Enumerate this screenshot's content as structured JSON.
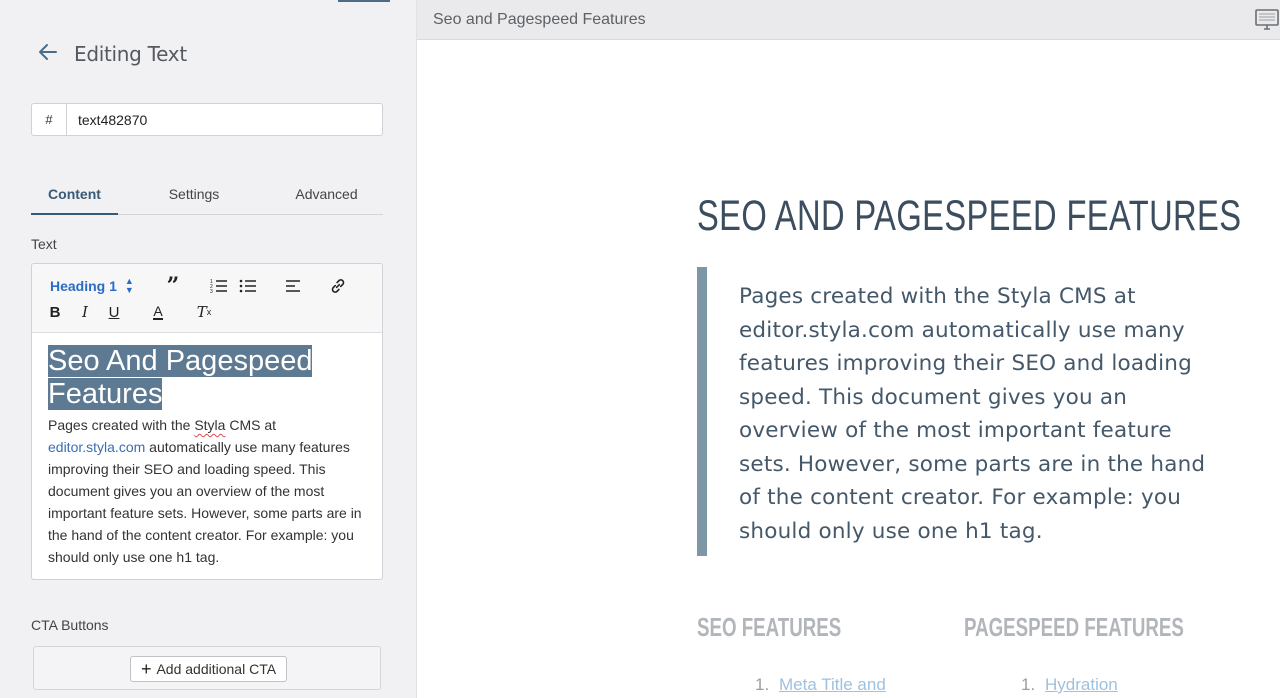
{
  "panel": {
    "title": "Editing Text",
    "id_prefix": "#",
    "id_value": "text482870",
    "tabs": [
      {
        "label": "Content",
        "active": true
      },
      {
        "label": "Settings",
        "active": false
      },
      {
        "label": "Advanced",
        "active": false
      }
    ],
    "text_label": "Text",
    "toolbar": {
      "heading_select": "Heading 1",
      "quote": "”",
      "bold": "B",
      "italic": "I",
      "underline": "U",
      "font_color": "A",
      "clear_format": "T"
    },
    "editor": {
      "heading_line1": "Seo And Pagespeed",
      "heading_line2": "Features",
      "para_part1": "Pages created with the ",
      "para_misspelled": "Styla",
      "para_part2": " CMS at ",
      "para_link": "editor.styla.com",
      "para_part3": " automatically use many features improving their SEO and loading speed. This document gives you an overview of the most important feature sets. However, some parts are in the hand of the content creator. For example: you should only use one h1 tag."
    },
    "cta_label": "CTA Buttons",
    "cta_button": "Add additional CTA"
  },
  "preview": {
    "bar_title": "Seo and Pagespeed Features",
    "heading": "SEO AND PAGESPEED FEATURES",
    "quote": "Pages created with the Styla CMS at editor.styla.com automatically use many features improving their SEO and loading speed. This document gives you an overview of the most important feature sets. However, some parts are in the hand of the content creator. For example: you should only use one h1 tag.",
    "columns": [
      {
        "title": "SEO FEATURES",
        "first_item_number": "1.",
        "first_item": "Meta Title and"
      },
      {
        "title": "PAGESPEED FEATURES",
        "first_item_number": "1.",
        "first_item": "Hydration"
      }
    ]
  },
  "colors": {
    "accent": "#375a78",
    "heading_select": "#2a6cc4",
    "selection": "#5e7a93",
    "quote_bar": "#7e97a6",
    "link": "#9fc1de"
  },
  "icons": [
    "back-arrow-icon",
    "quote-icon",
    "ordered-list-icon",
    "bullet-list-icon",
    "align-left-icon",
    "link-icon",
    "monitor-icon",
    "plus-icon"
  ]
}
